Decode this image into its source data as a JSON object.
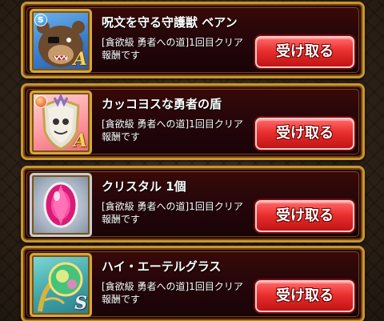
{
  "rewards": [
    {
      "title": "呪文を守る守護獣 ベアン",
      "desc_line1": "[貪欲級 勇者への道]1回目クリア",
      "desc_line2": "報酬です",
      "button_label": "受け取る",
      "icon": "bear-monster-icon",
      "element": "water",
      "element_mark": "S",
      "rank": "A"
    },
    {
      "title": "カッコヨスな勇者の盾",
      "desc_line1": "[貪欲級 勇者への道]1回目クリア",
      "desc_line2": "報酬です",
      "button_label": "受け取る",
      "icon": "shield-monster-icon",
      "element": "fire",
      "element_mark": "",
      "rank": "A"
    },
    {
      "title": "クリスタル 1個",
      "desc_line1": "[貪欲級 勇者への道]1回目クリア",
      "desc_line2": "報酬です",
      "button_label": "受け取る",
      "icon": "crystal-gem-icon",
      "element": "",
      "element_mark": "",
      "rank": ""
    },
    {
      "title": "ハイ・エーテルグラス",
      "desc_line1": "[貪欲級 勇者への道]1回目クリア",
      "desc_line2": "報酬です",
      "button_label": "受け取る",
      "icon": "ether-glass-icon",
      "element": "",
      "element_mark": "",
      "rank": "S"
    }
  ],
  "colors": {
    "button": "#e02525",
    "frame_gold": "#c9952f",
    "card_bg": "#2a0608"
  }
}
